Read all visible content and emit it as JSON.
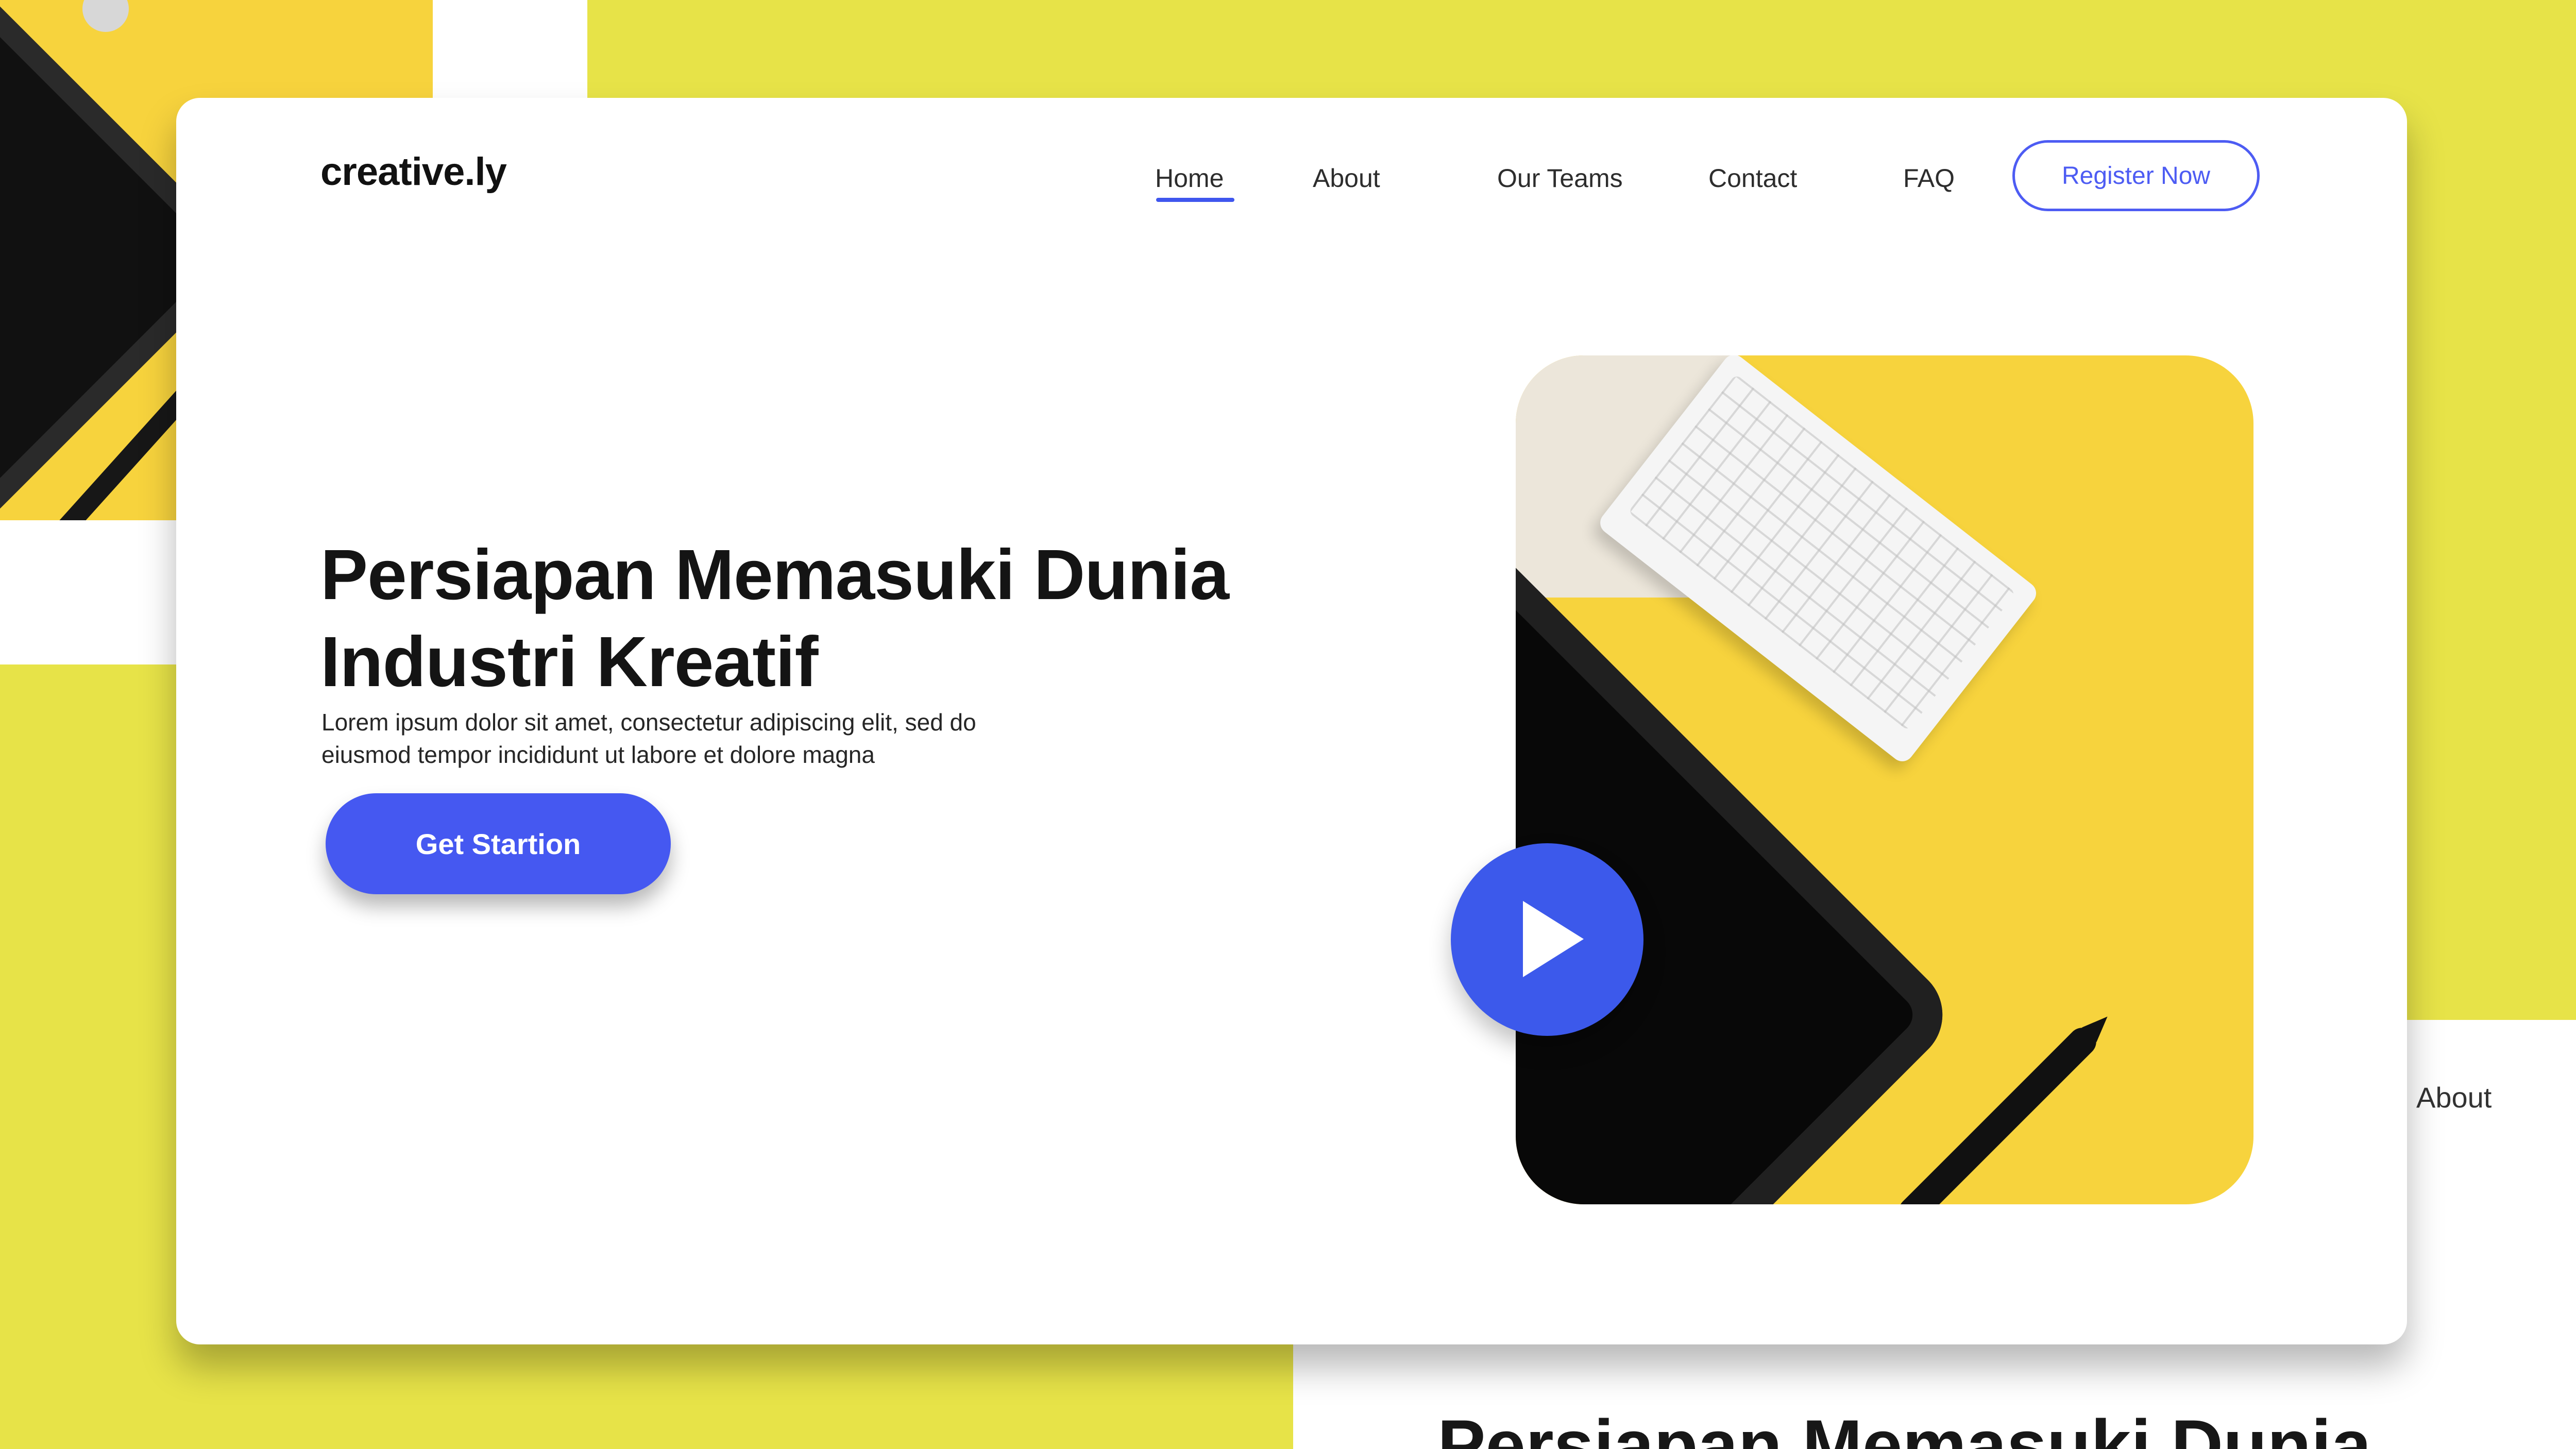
{
  "background": {
    "about_label": "About",
    "heading_preview": "Persiapan Memasuki Dunia"
  },
  "header": {
    "logo": "creative.ly",
    "nav": {
      "home": "Home",
      "about": "About",
      "our_teams": "Our Teams",
      "contact": "Contact",
      "faq": "FAQ"
    },
    "register_label": "Register Now"
  },
  "hero": {
    "title_line_1": "Persiapan Memasuki Dunia",
    "title_line_2": "Industri Kreatif",
    "body_line_1": "Lorem ipsum dolor sit amet, consectetur adipiscing elit, sed do",
    "body_line_2": "eiusmod tempor incididunt ut labore et dolore magna",
    "cta_label": "Get Startion"
  },
  "icons": {
    "play": "play-icon"
  },
  "colors": {
    "background_yellow": "#e7e348",
    "accent_blue": "#4558f1",
    "image_yellow": "#f7d33d",
    "card_white": "#ffffff",
    "text_dark": "#141414"
  }
}
